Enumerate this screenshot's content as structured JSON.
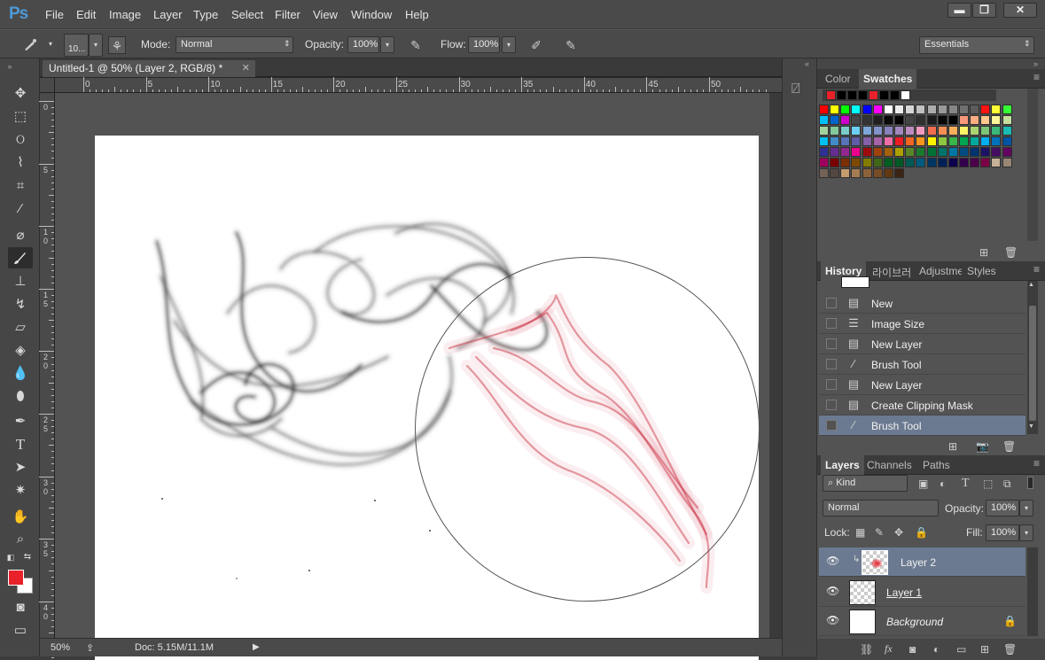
{
  "app": {
    "logo": "Ps",
    "menus": [
      "File",
      "Edit",
      "Image",
      "Layer",
      "Type",
      "Select",
      "Filter",
      "View",
      "Window",
      "Help"
    ],
    "window_buttons": {
      "minimize": "▬",
      "maximize": "❐",
      "close": "✕"
    }
  },
  "options_bar": {
    "brush_size": "10...",
    "mode_label": "Mode:",
    "mode_value": "Normal",
    "opacity_label": "Opacity:",
    "opacity_value": "100%",
    "flow_label": "Flow:",
    "flow_value": "100%",
    "workspace": "Essentials"
  },
  "document": {
    "tab_title": "Untitled-1 @ 50% (Layer 2, RGB/8) *",
    "ruler_h": [
      "0",
      "5",
      "10",
      "15",
      "20",
      "25",
      "30",
      "35",
      "40",
      "45",
      "50"
    ],
    "ruler_v": [
      "0",
      "5",
      "1 0",
      "1 5",
      "2 0",
      "2 5",
      "3 0",
      "3 5",
      "4 0"
    ],
    "zoom": "50%",
    "doc_size": "Doc: 5.15M/11.1M"
  },
  "colors": {
    "foreground": "#e8212a",
    "background": "#ffffff",
    "smoke_dark": "#1a1a1a",
    "smoke_red": "#c8283a"
  },
  "swatches_panel": {
    "tabs": [
      "Color",
      "Swatches"
    ],
    "active": "Swatches",
    "recent": [
      "#e8212a",
      "#000000",
      "#000000",
      "#000000",
      "#e8212a",
      "#000000",
      "#000000",
      "#ffffff"
    ],
    "rows": [
      [
        "#ff0000",
        "#ffff00",
        "#00ff00",
        "#00ffff",
        "#0000ff",
        "#ff00ff",
        "#ffffff",
        "#ebebeb",
        "#d6d6d6",
        "#c2c2c2",
        "#adadad",
        "#999999",
        "#858585",
        "#707070",
        "#5c5c5c",
        "#ff1414",
        "#ffff33",
        "#33ff33"
      ],
      [
        "#00bfff",
        "#0066cc",
        "#cc00cc",
        "#474747",
        "#333333",
        "#1f1f1f",
        "#0a0a0a",
        "#000000",
        "#454545",
        "#303030",
        "#1c1c1c",
        "#080808",
        "#000000",
        "#f7977a",
        "#fbad82",
        "#fdc68c",
        "#fff799",
        "#c4df9b"
      ],
      [
        "#a3d39c",
        "#82ca9c",
        "#7accc8",
        "#6dcff6",
        "#7da7d8",
        "#8393ca",
        "#8781bd",
        "#a187be",
        "#bd8cbf",
        "#f49ac1",
        "#f26c4f",
        "#f68e56",
        "#fbaf5d",
        "#fff467",
        "#acd372",
        "#7cc576",
        "#3bb878",
        "#1abbb4"
      ],
      [
        "#00bff3",
        "#438ccb",
        "#5574b9",
        "#605ca8",
        "#855fa8",
        "#a763a9",
        "#ef6ea8",
        "#ed1c24",
        "#f26522",
        "#f7941d",
        "#fff200",
        "#8dc63f",
        "#39b54a",
        "#00a651",
        "#00a99d",
        "#00aeef",
        "#0072bc",
        "#0054a5"
      ],
      [
        "#2e3192",
        "#662d91",
        "#92278f",
        "#ec008c",
        "#9e0b0f",
        "#a0410d",
        "#a3620a",
        "#aba000",
        "#598527",
        "#1a7b30",
        "#007236",
        "#00746b",
        "#0076a3",
        "#004b80",
        "#003471",
        "#1b1464",
        "#440e62",
        "#630460"
      ],
      [
        "#9e005d",
        "#790000",
        "#7b2e00",
        "#7d4900",
        "#827b00",
        "#406618",
        "#005e20",
        "#005826",
        "#005952",
        "#005b7f",
        "#003663",
        "#002157",
        "#0d004c",
        "#32004b",
        "#4b0049",
        "#7b0046",
        "#c7b299",
        "#998675"
      ],
      [
        "#736357",
        "#534741",
        "#c69c6d",
        "#a67c52",
        "#8c6239",
        "#754c24",
        "#603913",
        "#3c2415"
      ]
    ]
  },
  "history_panel": {
    "tabs": [
      "History",
      "라이브러",
      "Adjustme",
      "Styles"
    ],
    "active": "History",
    "items": [
      {
        "label": "New",
        "icon": "doc"
      },
      {
        "label": "Image Size",
        "icon": "list"
      },
      {
        "label": "New Layer",
        "icon": "doc"
      },
      {
        "label": "Brush Tool",
        "icon": "brush"
      },
      {
        "label": "New Layer",
        "icon": "doc"
      },
      {
        "label": "Create Clipping Mask",
        "icon": "doc"
      },
      {
        "label": "Brush Tool",
        "icon": "brush"
      }
    ],
    "selected_index": 6
  },
  "layers_panel": {
    "tabs": [
      "Layers",
      "Channels",
      "Paths"
    ],
    "active": "Layers",
    "filter": "Kind",
    "blend_mode": "Normal",
    "opacity_label": "Opacity:",
    "opacity_value": "100%",
    "lock_label": "Lock:",
    "fill_label": "Fill:",
    "fill_value": "100%",
    "layers": [
      {
        "name": "Layer 2",
        "selected": true,
        "clipped": true
      },
      {
        "name": "Layer 1",
        "selected": false,
        "clipped": false
      },
      {
        "name": "Background",
        "selected": false,
        "clipped": false,
        "locked": true
      }
    ],
    "footer_icons": [
      "link-icon",
      "fx-icon",
      "mask-icon",
      "adjustment-icon",
      "group-icon",
      "new-layer-icon",
      "trash-icon"
    ]
  }
}
